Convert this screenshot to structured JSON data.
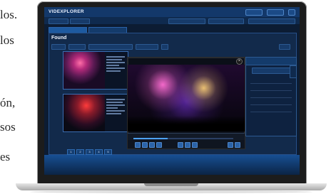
{
  "background_text": {
    "line1": "los.",
    "line2": "los",
    "line3": "ón,",
    "line4": "sos",
    "line5": "es"
  },
  "app": {
    "brand": "VIDEXPLORER",
    "top_links": [
      "",
      ""
    ],
    "found_title": "Found",
    "found_subtitle": "",
    "player_title": "",
    "panel_title": "",
    "pager_pages": [
      "1",
      "2",
      "3",
      "4",
      "5"
    ]
  },
  "colors": {
    "app_bg": "#0c1c33",
    "topbar": "#13386a",
    "accent": "#1d5aa0",
    "highlight": "#4ea2ff"
  },
  "player": {
    "progress": 0.34
  }
}
